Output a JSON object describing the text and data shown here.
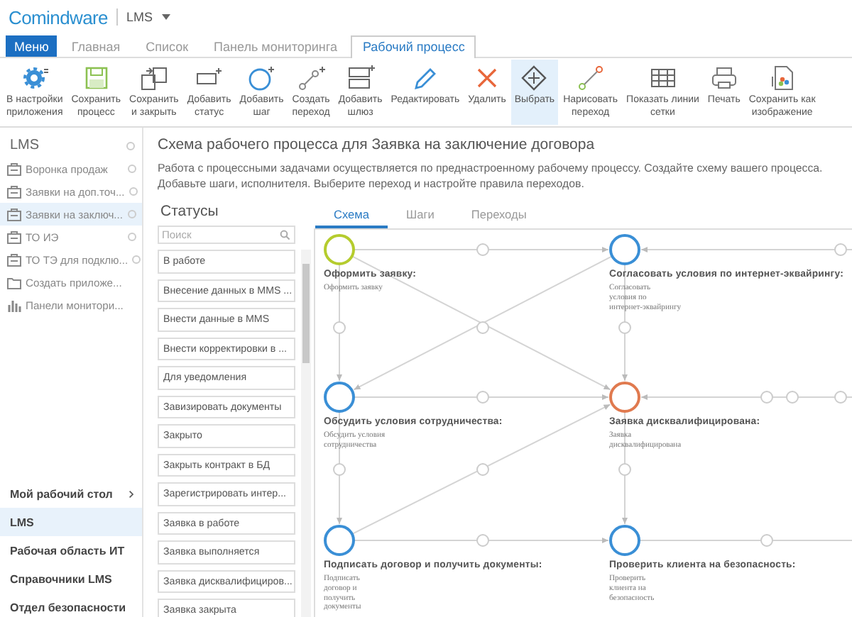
{
  "header": {
    "logo": "Comindware",
    "app": "LMS"
  },
  "menu_tabs": [
    {
      "label": "Меню",
      "kind": "menu",
      "selected": false
    },
    {
      "label": "Главная",
      "kind": "tab",
      "selected": false
    },
    {
      "label": "Список",
      "kind": "tab",
      "selected": false
    },
    {
      "label": "Панель мониторинга",
      "kind": "tab",
      "selected": false
    },
    {
      "label": "Рабочий процесс",
      "kind": "tab",
      "selected": true
    }
  ],
  "toolbar": [
    {
      "label": "В настройки\nприложения",
      "selected": false
    },
    {
      "label": "Сохранить\nпроцесс",
      "selected": false
    },
    {
      "label": "Сохранить\nи закрыть",
      "selected": false
    },
    {
      "label": "Добавить\nстатус",
      "selected": false
    },
    {
      "label": "Добавить\nшаг",
      "selected": false
    },
    {
      "label": "Создать\nпереход",
      "selected": false
    },
    {
      "label": "Добавить\nшлюз",
      "selected": false
    },
    {
      "label": "Редактировать",
      "selected": false
    },
    {
      "label": "Удалить",
      "selected": false
    },
    {
      "label": "Выбрать",
      "selected": true
    },
    {
      "label": "Нарисовать\nпереход",
      "selected": false
    },
    {
      "label": "Показать линии\nсетки",
      "selected": false
    },
    {
      "label": "Печать",
      "selected": false
    },
    {
      "label": "Сохранить как\nизображение",
      "selected": false
    }
  ],
  "sidebar": {
    "title": "LMS",
    "items": [
      {
        "label": "Воронка продаж",
        "kind": "app",
        "selected": false
      },
      {
        "label": "Заявки на доп.точ...",
        "kind": "app",
        "selected": false
      },
      {
        "label": "Заявки на заключ...",
        "kind": "app",
        "selected": true
      },
      {
        "label": "ТО ИЭ",
        "kind": "app",
        "selected": false
      },
      {
        "label": "ТО ТЭ для подклю...",
        "kind": "app",
        "selected": false
      },
      {
        "label": "Создать приложе...",
        "kind": "create",
        "selected": false
      },
      {
        "label": "Панели монитори...",
        "kind": "dashboard",
        "selected": false
      }
    ],
    "workspaces": [
      {
        "label": "Мой рабочий стол",
        "expandable": true,
        "selected": false
      },
      {
        "label": "LMS",
        "expandable": false,
        "selected": true
      },
      {
        "label": "Рабочая область ИТ",
        "expandable": false,
        "selected": false
      },
      {
        "label": "Справочники LMS",
        "expandable": false,
        "selected": false
      },
      {
        "label": "Отдел безопасности",
        "expandable": false,
        "selected": false
      }
    ]
  },
  "page": {
    "title": "Схема рабочего процесса для Заявка на заключение договора",
    "description": "Работа с процессными задачами осуществляется по преднастроенному рабочему процессу. Создайте схему вашего процесса. Добавьте шаги, исполнителя. Выберите переход и настройте правила переходов."
  },
  "statuses": {
    "title": "Статусы",
    "search_placeholder": "Поиск",
    "items": [
      "В работе",
      "Внесение данных в MMS ...",
      "Внести данные в MMS",
      "Внести корректировки в ...",
      "Для уведомления",
      "Завизировать документы",
      "Закрыто",
      "Закрыть контракт в БД",
      "Зарегистрировать интер...",
      "Заявка в работе",
      "Заявка выполняется",
      "Заявка дисквалифициров...",
      "Заявка закрыта"
    ]
  },
  "diagram_tabs": [
    {
      "label": "Схема",
      "selected": true
    },
    {
      "label": "Шаги",
      "selected": false
    },
    {
      "label": "Переходы",
      "selected": false
    }
  ],
  "steps": [
    {
      "title": "Оформить заявку:",
      "description": "Оформить заявку",
      "color": "#b5cc2e"
    },
    {
      "title": "Согласовать условия по интернет-эквайрингу:",
      "description": "Согласовать\nусловия по\nинтернет-эквайрингу",
      "color": "#3a8fd6"
    },
    {
      "title": "Обсудить условия сотрудничества:",
      "description": "Обсудить условия\nсотрудничества",
      "color": "#3a8fd6"
    },
    {
      "title": "Заявка дисквалифицирована:",
      "description": "Заявка\nдисквалифицирована",
      "color": "#e07a4f"
    },
    {
      "title": "Подписать договор и получить документы:",
      "description": "Подписать\nдоговор и\nполучить\nдокументы",
      "color": "#3a8fd6"
    },
    {
      "title": "Проверить клиента на безопасность:",
      "description": "Проверить\nклиента на\nбезопасность",
      "color": "#3a8fd6"
    }
  ]
}
